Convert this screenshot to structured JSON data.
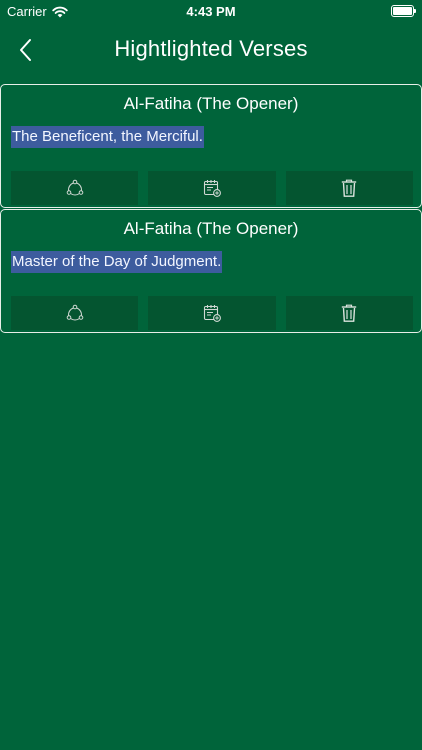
{
  "status": {
    "carrier": "Carrier",
    "time": "4:43 PM"
  },
  "nav": {
    "title": "Hightlighted Verses"
  },
  "verses": [
    {
      "surah": "Al-Fatiha (The Opener)",
      "text": "The Beneficent, the Merciful."
    },
    {
      "surah": "Al-Fatiha (The Opener)",
      "text": "Master of the Day of Judgment."
    }
  ],
  "icons": {
    "back": "chevron-left-icon",
    "share": "share-icon",
    "calendar": "calendar-add-icon",
    "delete": "trash-icon"
  },
  "colors": {
    "background": "#00643a",
    "button": "#045530",
    "highlight": "#3d5c9e",
    "border": "#e8efe9"
  }
}
